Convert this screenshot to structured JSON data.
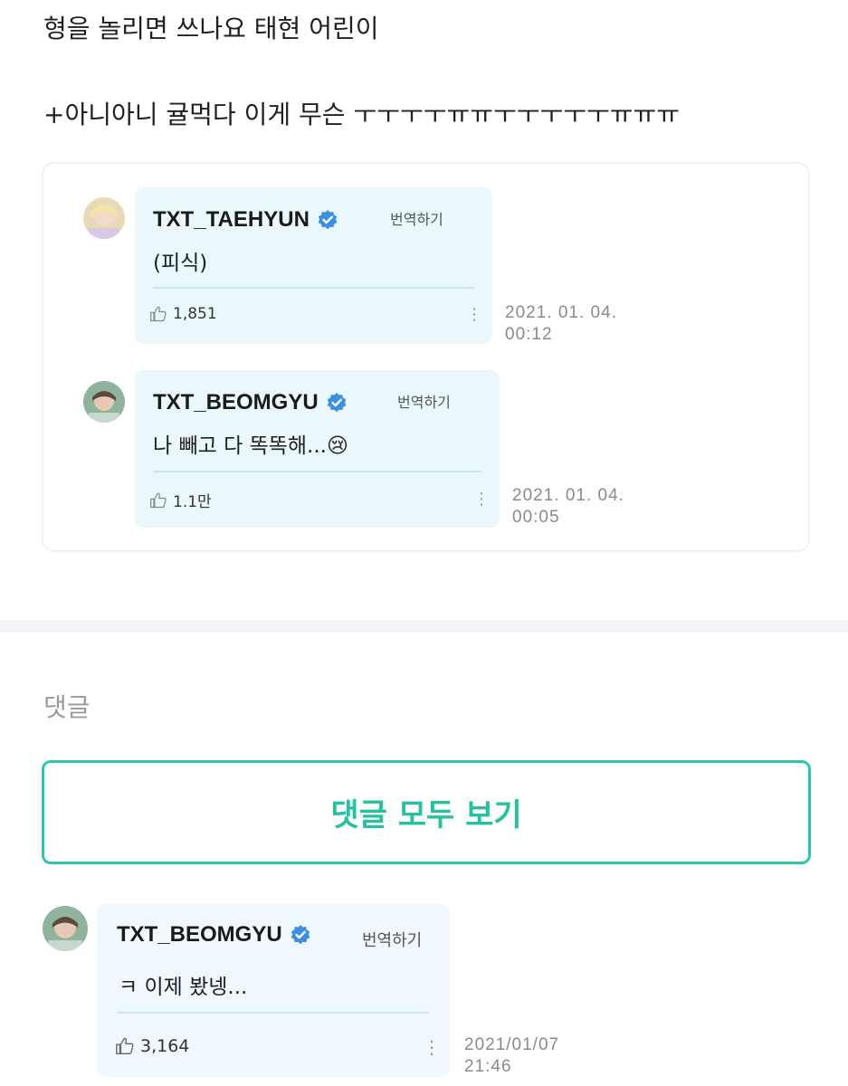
{
  "post": {
    "line1": "형을 놀리면 쓰나요 태현 어린이",
    "line2": "+아니아니 귤먹다 이게 무슨 ㅜㅜㅜㅜㅠㅠㅜㅜㅜㅜㅜㅠㅠㅠ"
  },
  "quoted_comments": [
    {
      "author": "TXT_TAEHYUN",
      "translate_label": "번역하기",
      "text": "(피식)",
      "likes": "1,851",
      "date": "2021. 01. 04.",
      "time": "00:12"
    },
    {
      "author": "TXT_BEOMGYU",
      "translate_label": "번역하기",
      "text": "나 빼고 다 똑똑해...😢",
      "likes": "1.1만",
      "date": "2021. 01. 04.",
      "time": "00:05"
    }
  ],
  "comments_section": {
    "label": "댓글",
    "view_all_label": "댓글 모두 보기"
  },
  "comment": {
    "author": "TXT_BEOMGYU",
    "translate_label": "번역하기",
    "text": "ㅋ 이제 봤넹...",
    "likes": "3,164",
    "date": "2021/01/07",
    "time": "21:46"
  },
  "colors": {
    "accent": "#2ec6a7",
    "verified": "#3d8fe0",
    "bubble": "#eaf8fb"
  },
  "icons": [
    "verified-badge-icon",
    "thumbs-up-icon",
    "more-vertical-icon"
  ]
}
